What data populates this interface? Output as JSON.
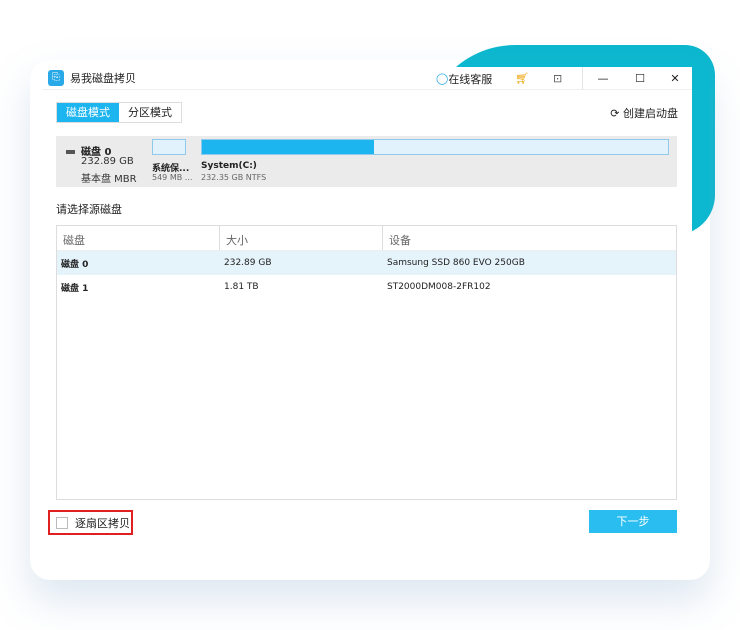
{
  "app": {
    "title": "易我磁盘拷贝",
    "support": "在线客服"
  },
  "tabs": [
    {
      "label": "磁盘模式"
    },
    {
      "label": "分区模式"
    }
  ],
  "boot_disk": "创建启动盘",
  "disk": {
    "name": "磁盘 0",
    "size": "232.89 GB",
    "type": "基本盘 MBR",
    "partitions": [
      {
        "label": "系统保...",
        "info": "549 MB ..."
      },
      {
        "label": "System(C:)",
        "info": "232.35 GB NTFS",
        "used_fraction": 0.37
      }
    ]
  },
  "source_label": "请选择源磁盘",
  "table": {
    "headers": [
      "磁盘",
      "大小",
      "设备"
    ],
    "rows": [
      [
        "磁盘 0",
        "232.89 GB",
        "Samsung SSD 860 EVO 250GB"
      ],
      [
        "磁盘 1",
        "1.81 TB",
        "ST2000DM008-2FR102"
      ]
    ]
  },
  "sector_copy": "逐扇区拷贝",
  "next": "下一步"
}
